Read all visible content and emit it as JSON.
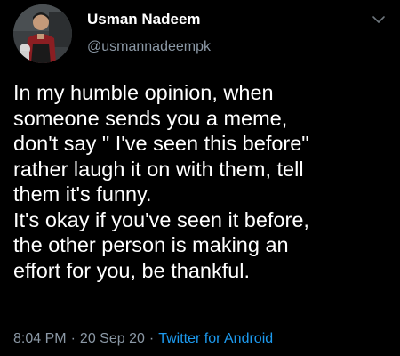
{
  "author": {
    "display_name": "Usman Nadeem",
    "handle": "@usmannadeempk"
  },
  "tweet": {
    "lines": [
      "In my humble opinion, when",
      "someone sends you a meme,",
      "don't say \" I've seen this before\"",
      "rather laugh it on with them, tell",
      "them it's funny.",
      "It's okay if you've seen it before,",
      "the other person is making an",
      "effort for you, be thankful."
    ],
    "time": "8:04 PM",
    "date": "20 Sep 20",
    "source": "Twitter for Android",
    "separator": "·"
  },
  "icons": {
    "menu": "chevron-down-icon",
    "avatar": "avatar-photo"
  },
  "colors": {
    "background": "#000000",
    "text": "#ffffff",
    "secondary": "#8b98a5",
    "link": "#1d9bf0"
  }
}
